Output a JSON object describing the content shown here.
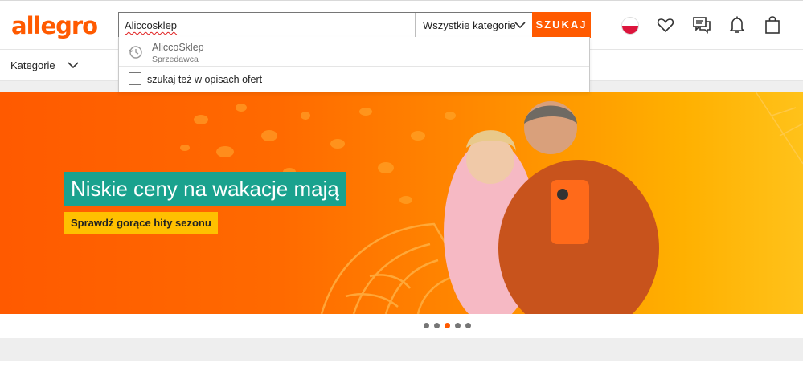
{
  "header": {
    "logo": "allegro",
    "search": {
      "value": "Aliccosklep"
    },
    "category": {
      "selected": "Wszystkie kategorie"
    },
    "search_button": "SZUKAJ"
  },
  "dropdown": {
    "suggestion": {
      "name": "AliccoSklep",
      "role": "Sprzedawca"
    },
    "checkbox_label": "szukaj też w opisach ofert"
  },
  "nav": {
    "categories_label": "Kategorie"
  },
  "banner": {
    "headline": "Niskie ceny na wakacje mają",
    "cta": "Sprawdź gorące hity sezonu"
  },
  "carousel": {
    "total": 5,
    "active": 3
  },
  "colors": {
    "brand": "#ff5a00",
    "headline_bg": "#1aa28e",
    "cta_bg": "#ffc000"
  },
  "icons": [
    "flag-pl-icon",
    "heart-icon",
    "chat-icon",
    "bell-icon",
    "cart-icon",
    "history-icon",
    "chevron-down-icon"
  ]
}
